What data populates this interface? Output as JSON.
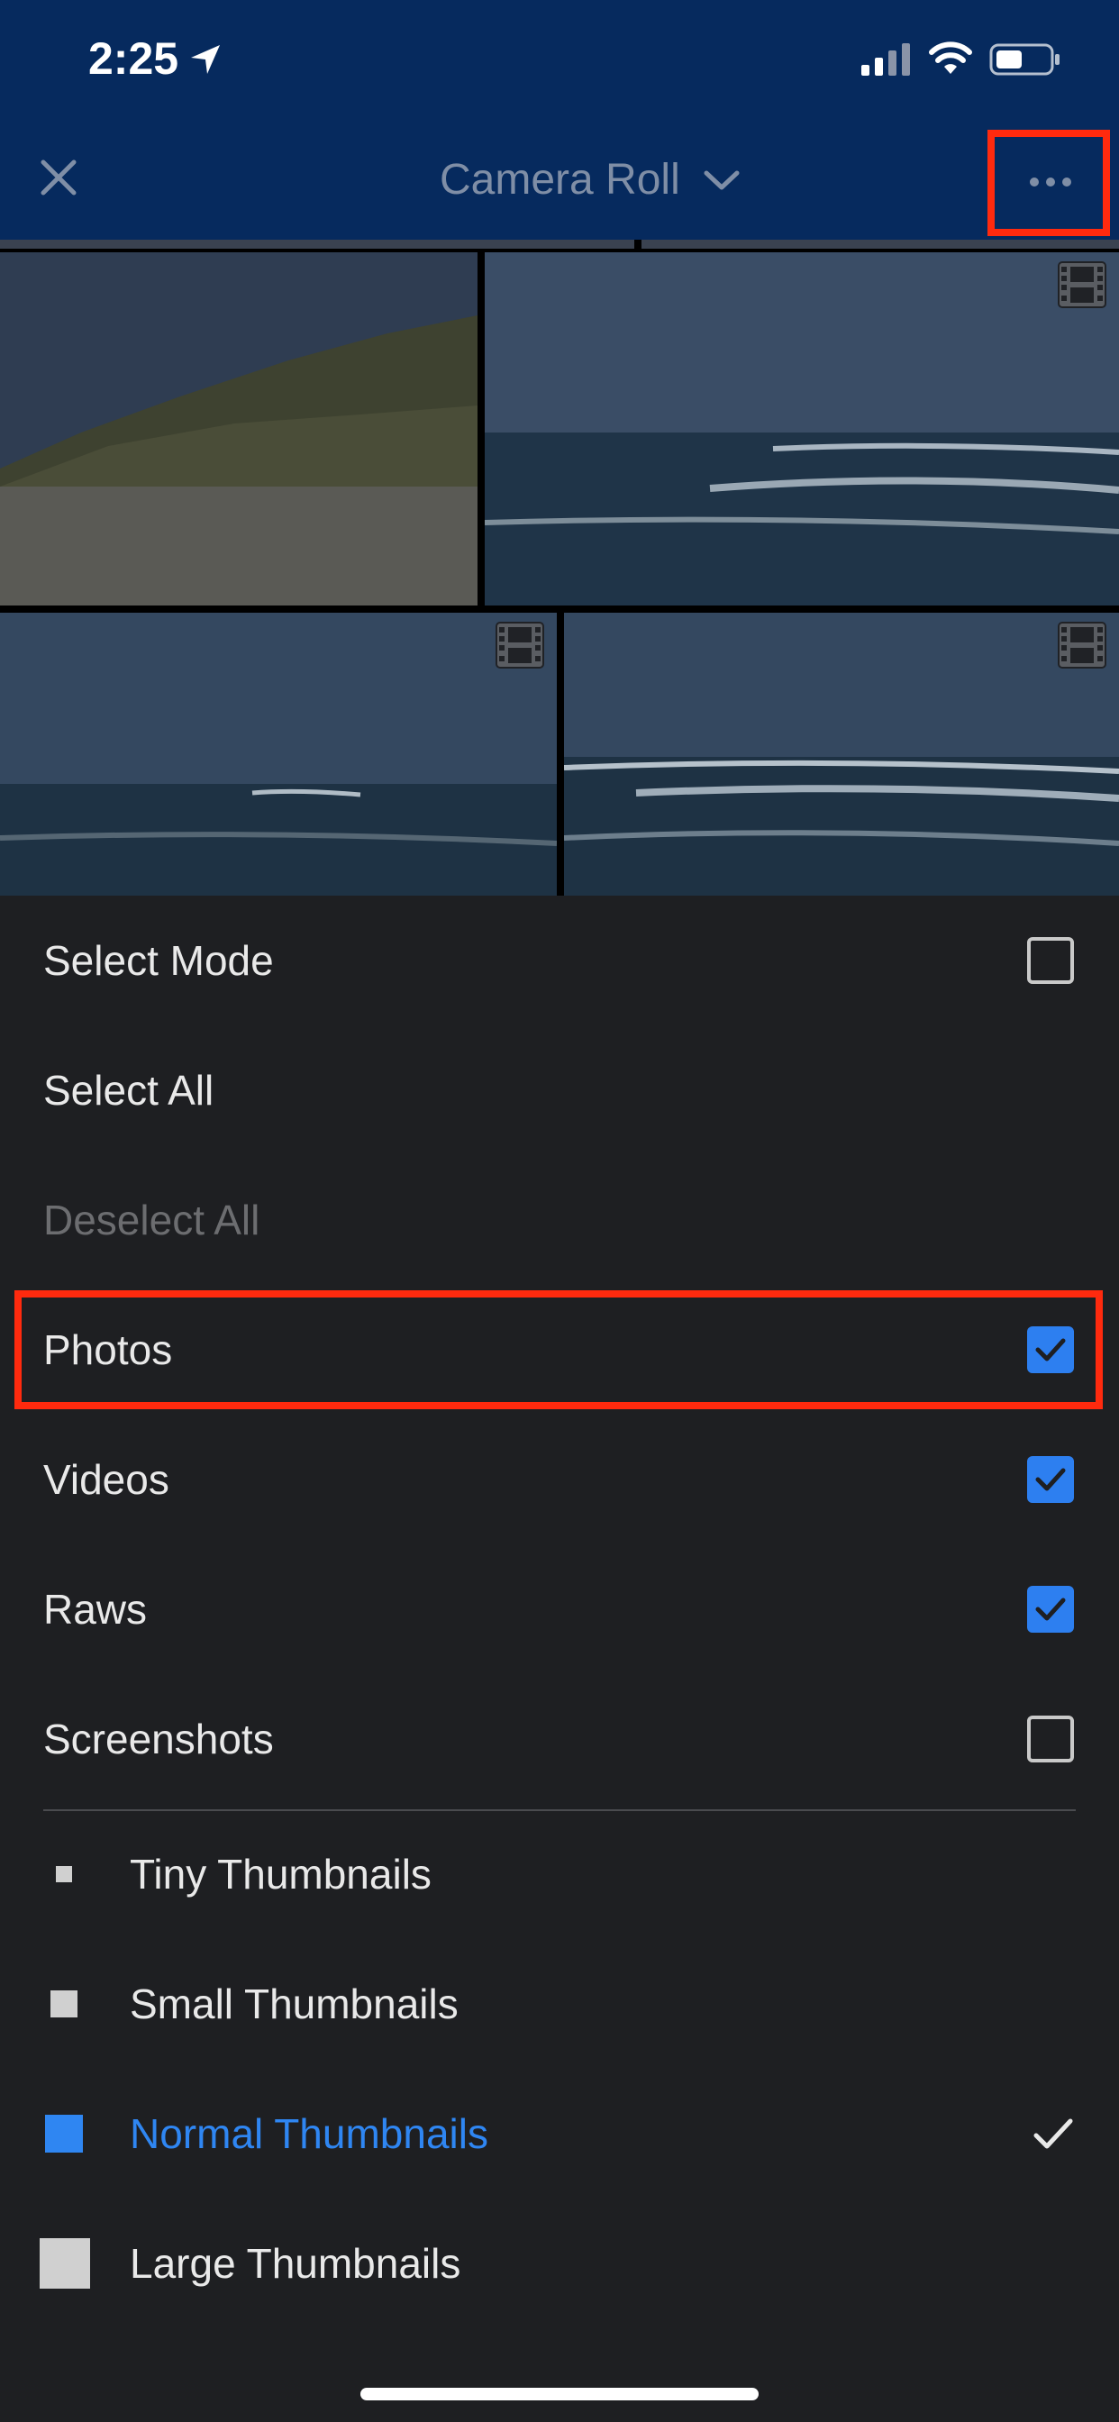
{
  "status_bar": {
    "time": "2:25"
  },
  "header": {
    "title": "Camera Roll"
  },
  "menu": {
    "items": [
      {
        "label": "Select Mode",
        "checked": false,
        "disabled": false
      },
      {
        "label": "Select All",
        "disabled": false
      },
      {
        "label": "Deselect All",
        "disabled": true
      },
      {
        "label": "Photos",
        "checked": true
      },
      {
        "label": "Videos",
        "checked": true
      },
      {
        "label": "Raws",
        "checked": true
      },
      {
        "label": "Screenshots",
        "checked": false
      }
    ],
    "thumbnail_sizes": [
      {
        "label": "Tiny Thumbnails",
        "selected": false
      },
      {
        "label": "Small Thumbnails",
        "selected": false
      },
      {
        "label": "Normal Thumbnails",
        "selected": true
      },
      {
        "label": "Large Thumbnails",
        "selected": false
      }
    ]
  },
  "colors": {
    "accent": "#2d7ff0",
    "header_bg": "#062a5e",
    "menu_bg": "#1e1f22",
    "annotation": "#ff2a0e"
  },
  "icons": [
    "location-arrow-icon",
    "cellular-signal-icon",
    "wifi-icon",
    "battery-icon",
    "close-icon",
    "chevron-down-icon",
    "more-options-icon",
    "video-film-icon",
    "checkmark-icon"
  ]
}
